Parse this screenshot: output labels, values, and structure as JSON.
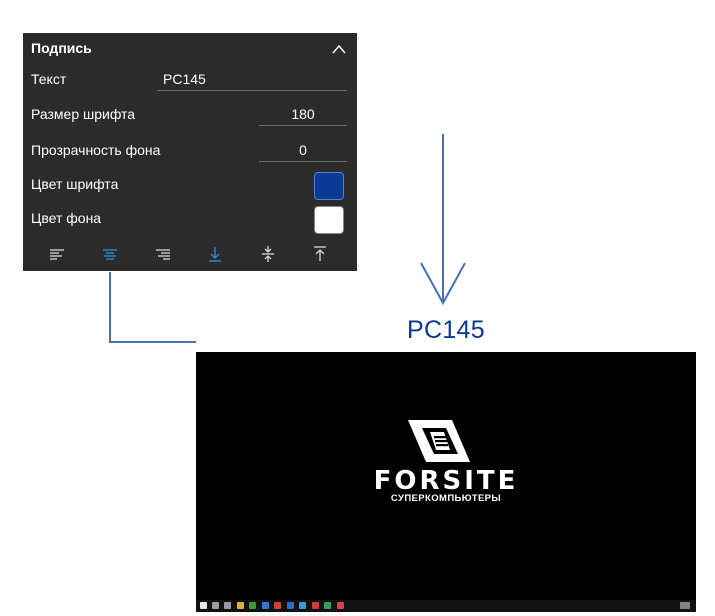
{
  "panel": {
    "title": "Подпись",
    "rows": {
      "text": {
        "label": "Текст",
        "value": "PC145"
      },
      "font_size": {
        "label": "Размер шрифта",
        "value": "180"
      },
      "bg_opacity": {
        "label": "Прозрачность фона",
        "value": "0"
      },
      "font_color": {
        "label": "Цвет шрифта",
        "color": "#0a3a96"
      },
      "bg_color": {
        "label": "Цвет фона",
        "color": "#ffffff"
      }
    },
    "toolbar": {
      "active_color": "#2f8fe0",
      "icon_color": "#d8d8d8",
      "buttons": [
        "align-left-icon",
        "align-center-icon",
        "align-right-icon",
        "align-bottom-icon",
        "align-middle-icon",
        "align-top-icon"
      ]
    }
  },
  "preview": {
    "caption": "PC145",
    "brand": "FORSITE",
    "tagline": "СУПЕРКОМПЬЮТЕРЫ"
  },
  "colors": {
    "connector": "#4a6fb5",
    "panel_bg": "#2b2b2b"
  }
}
